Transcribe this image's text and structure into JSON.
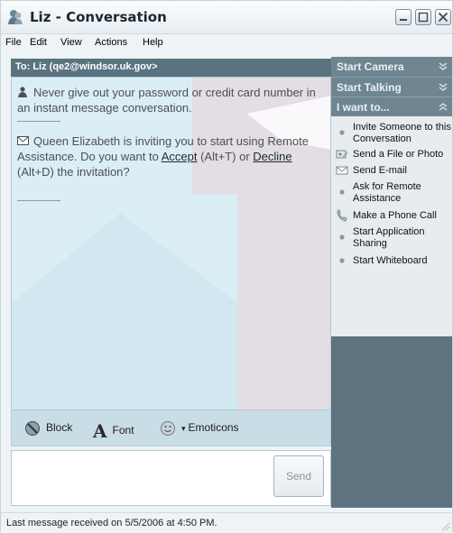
{
  "window": {
    "title": "Liz - Conversation",
    "controls": {
      "minimize": "minimize-icon",
      "maximize": "maximize-icon",
      "close": "close-icon"
    }
  },
  "menu": [
    {
      "label": "File"
    },
    {
      "label": "Edit"
    },
    {
      "label": "View"
    },
    {
      "label": "Actions"
    },
    {
      "label": "Help"
    }
  ],
  "conversation": {
    "to_line": "To:  Liz (qe2@windsor.uk.gov>",
    "security_notice": "Never give out your password or credit card number in an instant message conversation.",
    "invite": {
      "text_before": "Queen Elizabeth is inviting you to start using Remote Assistance. Do you want to",
      "accept_label": "Accept",
      "accept_shortcut": "(Alt+T)",
      "or_text": "or",
      "decline_label": "Decline",
      "decline_shortcut": "(Alt+D) the invitation?"
    }
  },
  "toolbar": {
    "block_label": "Block",
    "font_label": "Font",
    "emoticons_label": "Emoticons"
  },
  "input": {
    "value": "",
    "send_label": "Send"
  },
  "sidebar": {
    "start_camera": "Start Camera",
    "start_talking": "Start Talking",
    "i_want_to": "I want to...",
    "items": [
      {
        "label": "Invite Someone to this Conversation",
        "icon": "bullet-icon"
      },
      {
        "label": "Send a File or Photo",
        "icon": "file-photo-icon"
      },
      {
        "label": "Send E-mail",
        "icon": "envelope-icon"
      },
      {
        "label": "Ask for Remote Assistance",
        "icon": "bullet-icon"
      },
      {
        "label": "Make a Phone Call",
        "icon": "phone-icon"
      },
      {
        "label": "Start Application Sharing",
        "icon": "bullet-icon"
      },
      {
        "label": "Start Whiteboard",
        "icon": "bullet-icon"
      }
    ]
  },
  "status": {
    "text": "Last message received on 5/5/2006 at 4:50 PM."
  },
  "colors": {
    "accent": "#5d7380",
    "conversation_bg": "#dbeef5",
    "watermark_red": "#e4c7d1"
  }
}
